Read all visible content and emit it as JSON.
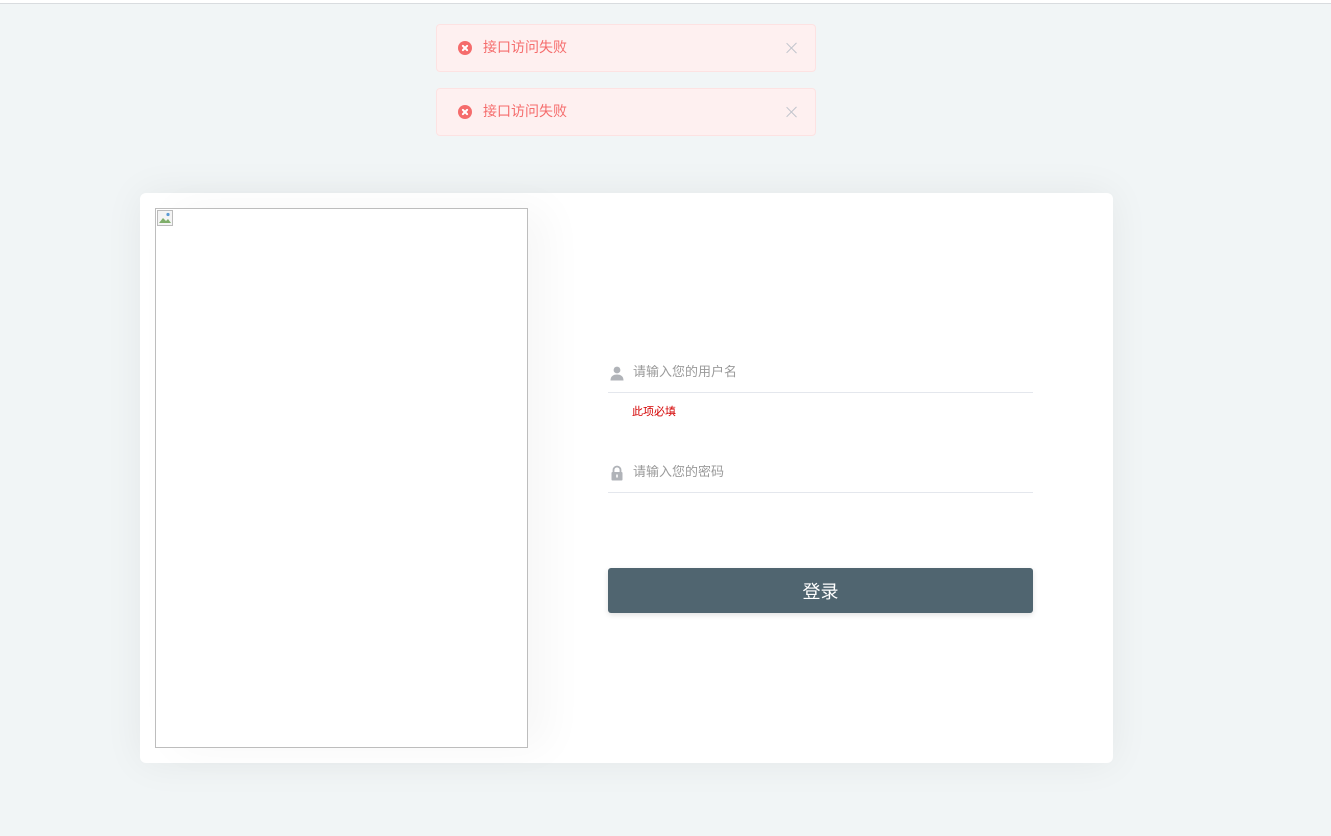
{
  "toasts": [
    {
      "message": "接口访问失败"
    },
    {
      "message": "接口访问失败"
    }
  ],
  "login": {
    "username_placeholder": "请输入您的用户名",
    "username_value": "",
    "username_error": "此项必填",
    "password_placeholder": "请输入您的密码",
    "password_value": "",
    "submit_label": "登录"
  },
  "colors": {
    "error": "#f56c6c",
    "button": "#506570",
    "background": "#f1f5f6"
  }
}
